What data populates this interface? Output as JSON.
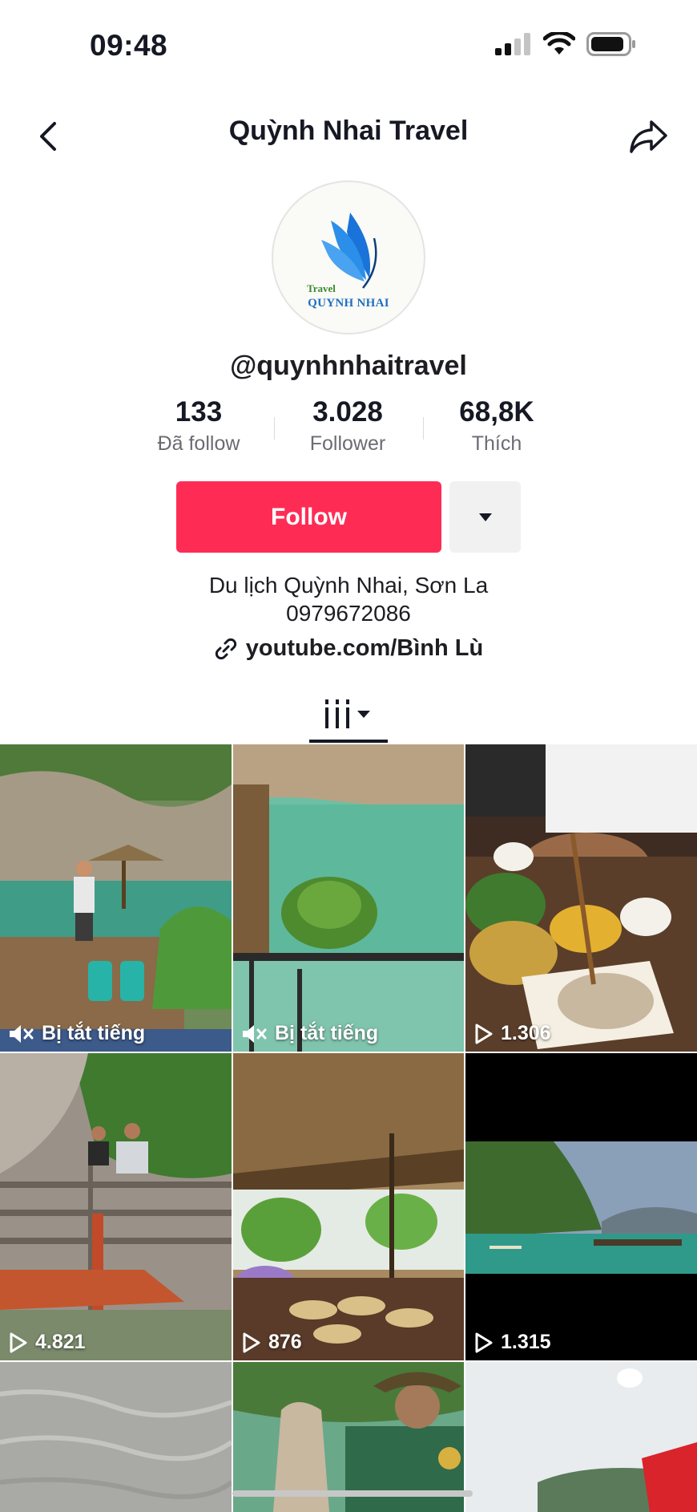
{
  "status_bar": {
    "time": "09:48",
    "icons": [
      "signal-icon",
      "wifi-icon",
      "battery-icon"
    ]
  },
  "nav": {
    "title": "Quỳnh Nhai Travel",
    "back_icon": "chevron-left-icon",
    "share_icon": "share-icon"
  },
  "profile": {
    "avatar_logo_line1": "Travel",
    "avatar_logo_line2": "QUYNH NHAI",
    "username": "@quynhnhaitravel",
    "stats": [
      {
        "value": "133",
        "label": "Đã follow"
      },
      {
        "value": "3.028",
        "label": "Follower"
      },
      {
        "value": "68,8K",
        "label": "Thích"
      }
    ],
    "follow_label": "Follow",
    "more_icon": "caret-down-icon",
    "bio_lines": [
      "Du lịch Quỳnh Nhai, Sơn La",
      "0979672086"
    ],
    "link_text": "youtube.com/Bình Lù",
    "link_icon": "link-icon"
  },
  "tabs": {
    "icon": "grid-icon",
    "dropdown_icon": "caret-down-icon"
  },
  "videos": [
    {
      "overlay_type": "muted",
      "overlay_text": "Bị tắt tiếng",
      "icon": "muted-speaker-icon"
    },
    {
      "overlay_type": "muted",
      "overlay_text": "Bị tắt tiếng",
      "icon": "muted-speaker-icon"
    },
    {
      "overlay_type": "views",
      "overlay_text": "1.306",
      "icon": "play-icon"
    },
    {
      "overlay_type": "views",
      "overlay_text": "4.821",
      "icon": "play-icon"
    },
    {
      "overlay_type": "views",
      "overlay_text": "876",
      "icon": "play-icon"
    },
    {
      "overlay_type": "views",
      "overlay_text": "1.315",
      "icon": "play-icon"
    },
    {
      "overlay_type": "none",
      "overlay_text": ""
    },
    {
      "overlay_type": "none",
      "overlay_text": ""
    },
    {
      "overlay_type": "none",
      "overlay_text": ""
    }
  ],
  "colors": {
    "follow_button": "#fe2c55",
    "more_button": "#f1f1f2",
    "text_primary": "#161823",
    "text_secondary": "#6b6b73"
  }
}
